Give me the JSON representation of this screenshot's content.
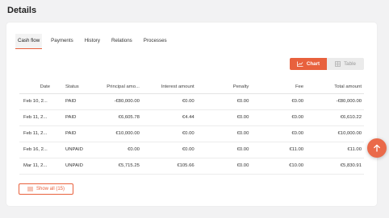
{
  "page": {
    "title": "Details"
  },
  "tabs": [
    {
      "label": "Cash flow",
      "active": true
    },
    {
      "label": "Payments"
    },
    {
      "label": "History"
    },
    {
      "label": "Relations"
    },
    {
      "label": "Processes"
    }
  ],
  "view_toggle": {
    "chart_label": "Chart",
    "table_label": "Table",
    "selected": "Chart"
  },
  "table": {
    "columns": [
      "Date",
      "Status",
      "Principal amo...",
      "Interest amount",
      "Penalty",
      "Fee",
      "Total amount"
    ],
    "rows": [
      [
        "Feb 10, 2...",
        "PAID",
        "-€80,000.00",
        "€0.00",
        "€0.00",
        "€0.00",
        "-€80,000.00"
      ],
      [
        "Feb 11, 2...",
        "PAID",
        "€6,605.78",
        "€4.44",
        "€0.00",
        "€0.00",
        "€6,610.22"
      ],
      [
        "Feb 11, 2...",
        "PAID",
        "€10,000.00",
        "€0.00",
        "€0.00",
        "€0.00",
        "€10,000.00"
      ],
      [
        "Feb 16, 2...",
        "UNPAID",
        "€0.00",
        "€0.00",
        "€0.00",
        "€11.00",
        "€11.00"
      ],
      [
        "Mar 11, 2...",
        "UNPAID",
        "€5,715.25",
        "€105.66",
        "€0.00",
        "€10.00",
        "€5,830.91"
      ]
    ]
  },
  "show_all": {
    "label": "Show all (15)"
  },
  "colors": {
    "accent": "#e8613d",
    "background": "#f2f2f3"
  },
  "icons": {
    "chart": "line-chart-icon",
    "table": "table-icon",
    "show_all": "list-icon",
    "fab": "arrow-up-icon"
  }
}
